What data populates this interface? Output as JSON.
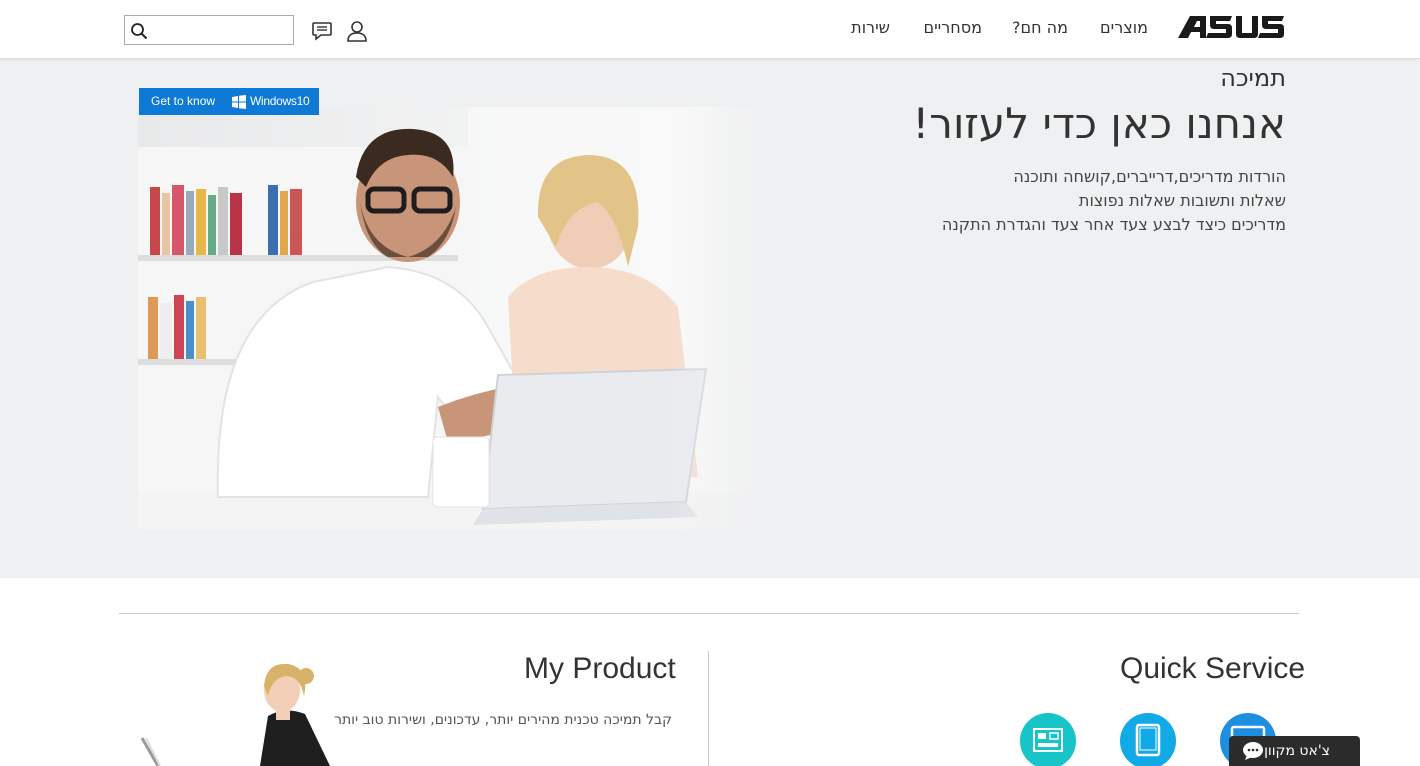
{
  "header": {
    "brand": "ASUS",
    "nav": [
      "מוצרים",
      "מה חם?",
      "מסחריים",
      "שירות"
    ],
    "search": {
      "value": "",
      "placeholder": ""
    }
  },
  "hero": {
    "badge_prefix": "Get to know",
    "badge_product": "Windows10",
    "subtitle": "תמיכה",
    "title": "אנחנו כאן כדי לעזור!",
    "lines": [
      "הורדות מדריכים,דרייברים,קושחה ותוכנה",
      "שאלות ותשובות שאלות נפוצות",
      "מדריכים כיצד לבצע צעד אחר צעד והגדרת התקנה"
    ]
  },
  "my_product": {
    "title": "My Product",
    "description": "קבל תמיכה טכנית מהירים יותר, עדכונים, ושירות טוב יותר"
  },
  "quick_service": {
    "title": "Quick Service",
    "icons": [
      "motherboard-icon",
      "tablet-icon",
      "desktop-icon"
    ]
  },
  "chat": {
    "label": "צ'אט מקוון"
  },
  "colors": {
    "hero_bg": "#eff0f1",
    "windows_blue": "#0f7ad6",
    "service_teal": "#17c4c8",
    "service_blue": "#11a9e6",
    "chat_bg": "#2b2b2b"
  }
}
